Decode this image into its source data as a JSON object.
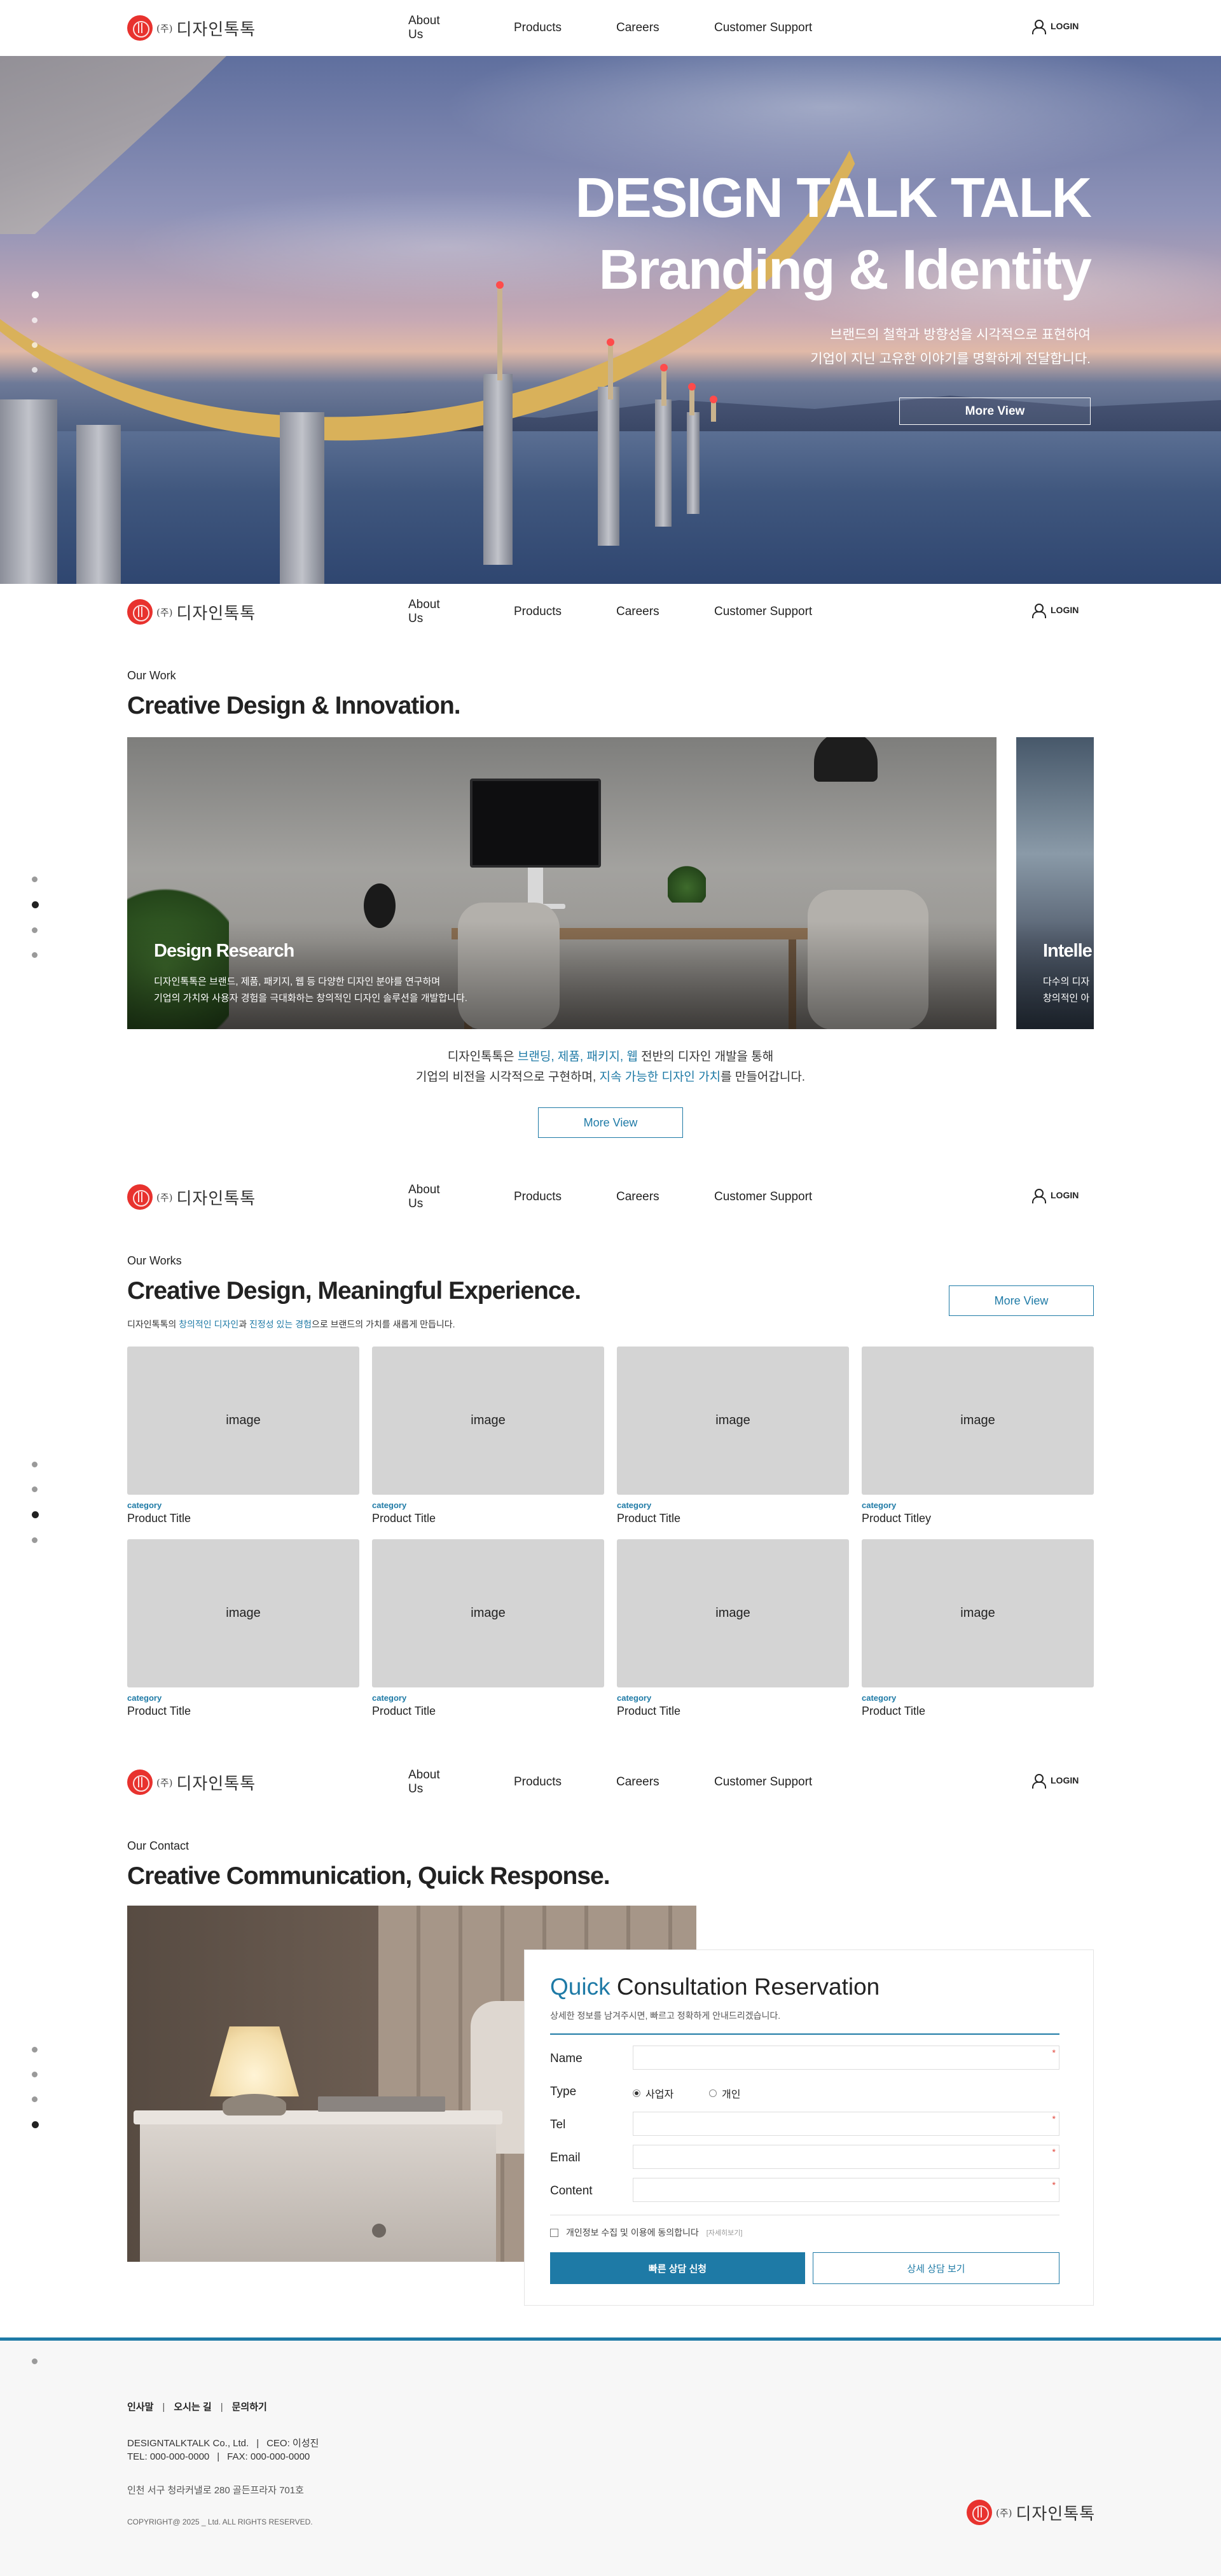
{
  "brand": {
    "corp_mark": "(주)",
    "name": "디자인톡톡",
    "accent_color": "#1e7aa6",
    "logo_color": "#e8322e"
  },
  "nav": {
    "items": [
      "About Us",
      "Products",
      "Careers",
      "Customer Support"
    ],
    "login": "LOGIN"
  },
  "hero": {
    "title_line1": "DESIGN TALK TALK",
    "title_line2": "Branding & Identity",
    "desc_line1": "브랜드의 철학과 방향성을 시각적으로 표현하여",
    "desc_line2": "기업이 지닌 고유한 이야기를 명확하게 전달합니다.",
    "button": "More View"
  },
  "work": {
    "eyebrow": "Our Work",
    "title": "Creative Design & Innovation.",
    "card_title": "Design Research",
    "card_desc_line1": "디자인톡톡은 브랜드, 제품, 패키지, 웹 등 다양한 디자인 분야를 연구하며",
    "card_desc_line2": "기업의 가치와 사용자 경험을 극대화하는 창의적인 디자인 솔루션을 개발합니다.",
    "side_card_title": "Intelle",
    "side_card_desc": "다수의 디자",
    "side_card_desc2": "창의적인 아",
    "desc1_before": "디자인톡톡은 ",
    "desc1_highlight": "브랜딩, 제품, 패키지, 웹",
    "desc1_after": " 전반의 디자인 개발을 통해",
    "desc2_before": "기업의 비전을 시각적으로 구현하며, ",
    "desc2_highlight": "지속 가능한 디자인 가치",
    "desc2_after": "를 만들어갑니다.",
    "button": "More View"
  },
  "works": {
    "eyebrow": "Our Works",
    "title": "Creative Design, Meaningful Experience.",
    "sub_before": "디자인톡톡의 ",
    "sub_hl1": "창의적인 디자인",
    "sub_mid": "과 ",
    "sub_hl2": "진정성 있는 경험",
    "sub_after": "으로 브랜드의 가치를 새롭게 만듭니다.",
    "button": "More View",
    "products": [
      {
        "image": "image",
        "category": "category",
        "title": "Product Title"
      },
      {
        "image": "image",
        "category": "category",
        "title": "Product Title"
      },
      {
        "image": "image",
        "category": "category",
        "title": "Product Title"
      },
      {
        "image": "image",
        "category": "category",
        "title": "Product Titley"
      },
      {
        "image": "image",
        "category": "category",
        "title": "Product Title"
      },
      {
        "image": "image",
        "category": "category",
        "title": "Product Title"
      },
      {
        "image": "image",
        "category": "category",
        "title": "Product Title"
      },
      {
        "image": "image",
        "category": "category",
        "title": "Product Title"
      }
    ]
  },
  "contact": {
    "eyebrow": "Our Contact",
    "title": "Creative Communication, Quick Response.",
    "form_title_highlight": "Quick",
    "form_title_rest": " Consultation Reservation",
    "form_sub": "상세한 정보를 남겨주시면, 빠르고 정확하게 안내드리겠습니다.",
    "fields": {
      "name": "Name",
      "type": "Type",
      "tel": "Tel",
      "email": "Email",
      "content": "Content"
    },
    "required_mark": "*",
    "type_options": [
      "사업자",
      "개인"
    ],
    "agree_text": "개인정보 수집 및 이용에 동의합니다",
    "agree_link": "[자세히보기]",
    "submit": "빠른 상담 신청",
    "detail": "상세 상담 보기"
  },
  "footer": {
    "links": [
      "인사말",
      "오시는 길",
      "문의하기"
    ],
    "company": "DESIGNTALKTALK Co., Ltd.",
    "ceo": "CEO: 이성진",
    "tel": "TEL: 000-000-0000",
    "fax": "FAX: 000-000-0000",
    "address": "인천 서구 청라커낼로 280 골든프라자 701호",
    "copyright": "COPYRIGHT@ 2025 _ Ltd. ALL RIGHTS RESERVED."
  }
}
